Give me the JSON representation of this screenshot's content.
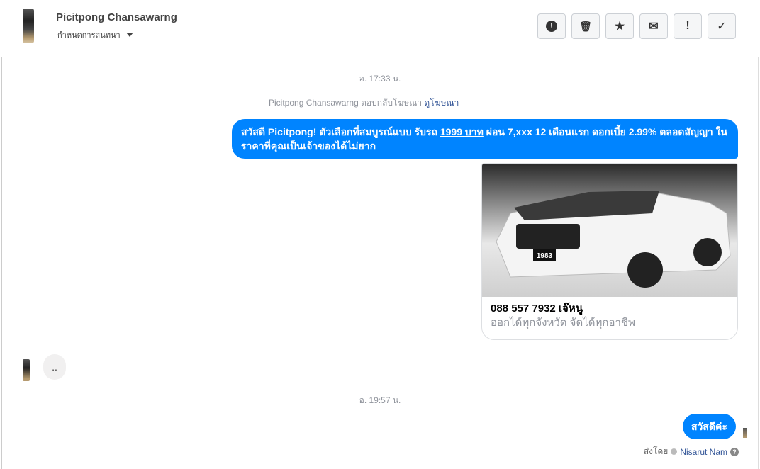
{
  "header": {
    "name": "Picitpong Chansawarng",
    "subtitle": "กำหนดการสนทนา"
  },
  "toolbar": [
    {
      "id": "report",
      "glyph": "!"
    },
    {
      "id": "delete",
      "glyph": "🗑"
    },
    {
      "id": "star",
      "glyph": "★"
    },
    {
      "id": "mail",
      "glyph": "✉"
    },
    {
      "id": "important",
      "glyph": "!"
    },
    {
      "id": "done",
      "glyph": "✓"
    }
  ],
  "thread": {
    "time1": "อ. 17:33 น.",
    "notice_text": "Picitpong Chansawarng ตอบกลับโฆษณา",
    "notice_link": "ดูโฆษณา",
    "msg1_a": "สวัสดี Picitpong! ตัวเลือกที่สมบูรณ์แบบ รับรถ ",
    "msg1_link": "1999 บาท",
    "msg1_b": " ผ่อน 7,xxx 12 เดือนแรก ดอกเบี้ย 2.99% ตลอดสัญญา ในราคาที่คุณเป็นเจ้าของได้ไม่ยาก",
    "card_title": "088 557 7932 เจ๊หนู",
    "card_subtitle": "ออกได้ทุกจังหวัด จัดได้ทุกอาชีพ",
    "plate": "1983",
    "incoming": "..",
    "time2": "อ. 19:57 น.",
    "msg2": "สวัสดีค่ะ",
    "sent_by": "ส่งโดย",
    "sender": "Nisarut Nam"
  }
}
